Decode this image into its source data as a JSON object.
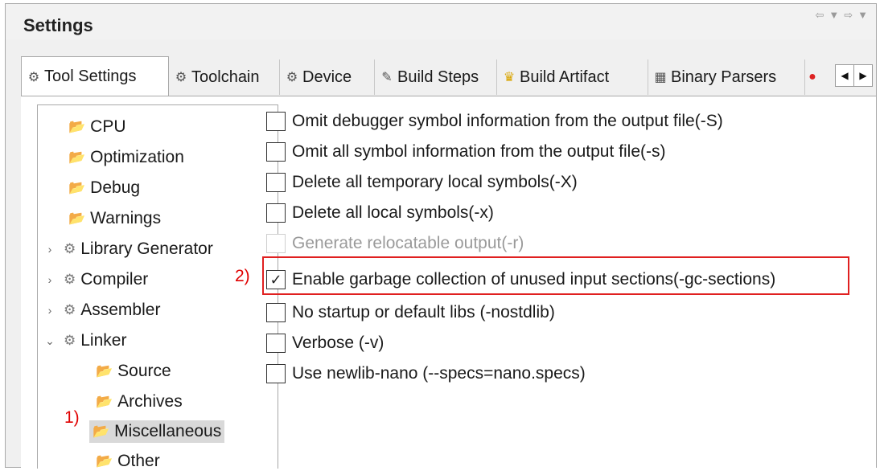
{
  "header": {
    "title": "Settings",
    "nav_back_icon": "back-arrow-icon",
    "nav_menu_icon": "dropdown-triangle-icon",
    "nav_forward_icon": "forward-arrow-icon"
  },
  "tabs": [
    {
      "label": "Tool Settings",
      "icon": "gear-icon",
      "active": true
    },
    {
      "label": "Toolchain",
      "icon": "gear-icon",
      "active": false
    },
    {
      "label": "Device",
      "icon": "gear-icon",
      "active": false
    },
    {
      "label": "Build Steps",
      "icon": "wrench-icon",
      "active": false
    },
    {
      "label": "Build Artifact",
      "icon": "trophy-icon",
      "active": false
    },
    {
      "label": "Binary Parsers",
      "icon": "binary-icon",
      "active": false
    }
  ],
  "tab_scroll": {
    "left": "◀",
    "right": "▶"
  },
  "tree": [
    {
      "label": "CPU",
      "type": "folder",
      "level": 1
    },
    {
      "label": "Optimization",
      "type": "folder",
      "level": 1
    },
    {
      "label": "Debug",
      "type": "folder",
      "level": 1
    },
    {
      "label": "Warnings",
      "type": "folder",
      "level": 1
    },
    {
      "label": "Library Generator",
      "type": "gear",
      "level": 0,
      "expand": "›"
    },
    {
      "label": "Compiler",
      "type": "gear",
      "level": 0,
      "expand": "›"
    },
    {
      "label": "Assembler",
      "type": "gear",
      "level": 0,
      "expand": "›"
    },
    {
      "label": "Linker",
      "type": "gear",
      "level": 0,
      "expand": "⌄"
    },
    {
      "label": "Source",
      "type": "folder",
      "level": 2
    },
    {
      "label": "Archives",
      "type": "folder",
      "level": 2
    },
    {
      "label": "Miscellaneous",
      "type": "folder",
      "level": 2,
      "selected": true
    },
    {
      "label": "Other",
      "type": "folder",
      "level": 2
    }
  ],
  "annotations": {
    "one": "1)",
    "two": "2)"
  },
  "options": [
    {
      "label": "Omit debugger symbol information from the output file(-S)",
      "checked": false,
      "disabled": false
    },
    {
      "label": "Omit all symbol information from the output file(-s)",
      "checked": false,
      "disabled": false
    },
    {
      "label": "Delete all temporary local symbols(-X)",
      "checked": false,
      "disabled": false
    },
    {
      "label": "Delete all local symbols(-x)",
      "checked": false,
      "disabled": false
    },
    {
      "label": "Generate relocatable output(-r)",
      "checked": false,
      "disabled": true
    },
    {
      "label": "Enable garbage collection of unused input sections(-gc-sections)",
      "checked": true,
      "disabled": false
    },
    {
      "label": "No startup or default libs (-nostdlib)",
      "checked": false,
      "disabled": false
    },
    {
      "label": "Verbose (-v)",
      "checked": false,
      "disabled": false
    },
    {
      "label": "Use newlib-nano (--specs=nano.specs)",
      "checked": false,
      "disabled": false
    }
  ],
  "colors": {
    "annotation": "#e00000",
    "selection": "#d9d9d9"
  }
}
